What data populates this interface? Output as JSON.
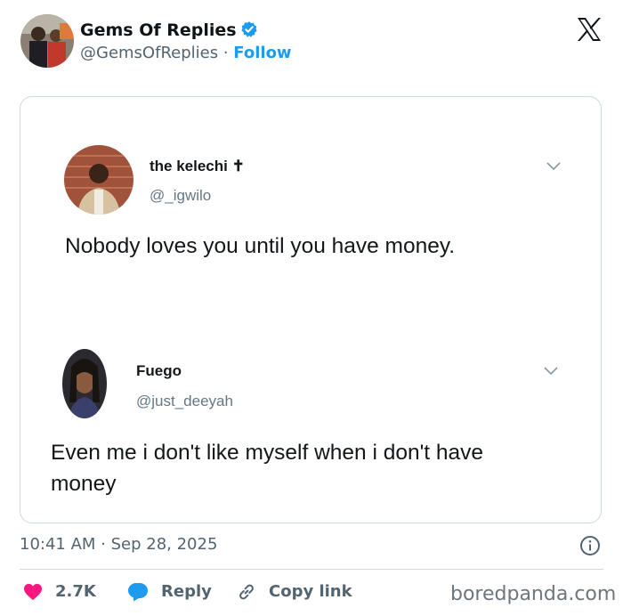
{
  "author": {
    "name": "Gems Of Replies",
    "handle": "@GemsOfReplies",
    "separator": "·",
    "follow_label": "Follow",
    "verified_color": "#1d9bf0"
  },
  "embedded": {
    "tweet1": {
      "name": "the kelechi ✝",
      "handle": "@_igwilo",
      "text": "Nobody loves you until you have money."
    },
    "tweet2": {
      "name": "Fuego",
      "handle": "@just_deeyah",
      "text_line1": "Even me i don't like myself when i don't have",
      "text_line2": "money"
    }
  },
  "footer": {
    "timestamp": "10:41 AM · Sep 28, 2025",
    "likes": "2.7K",
    "reply_label": "Reply",
    "copy_label": "Copy link",
    "like_color": "#f91880",
    "reply_color": "#1d9bf0"
  },
  "watermark": "boredpanda.com",
  "icons": [
    "x-logo-icon",
    "verified-badge-icon",
    "chevron-down-icon",
    "info-icon",
    "heart-icon",
    "reply-bubble-icon",
    "link-icon"
  ]
}
